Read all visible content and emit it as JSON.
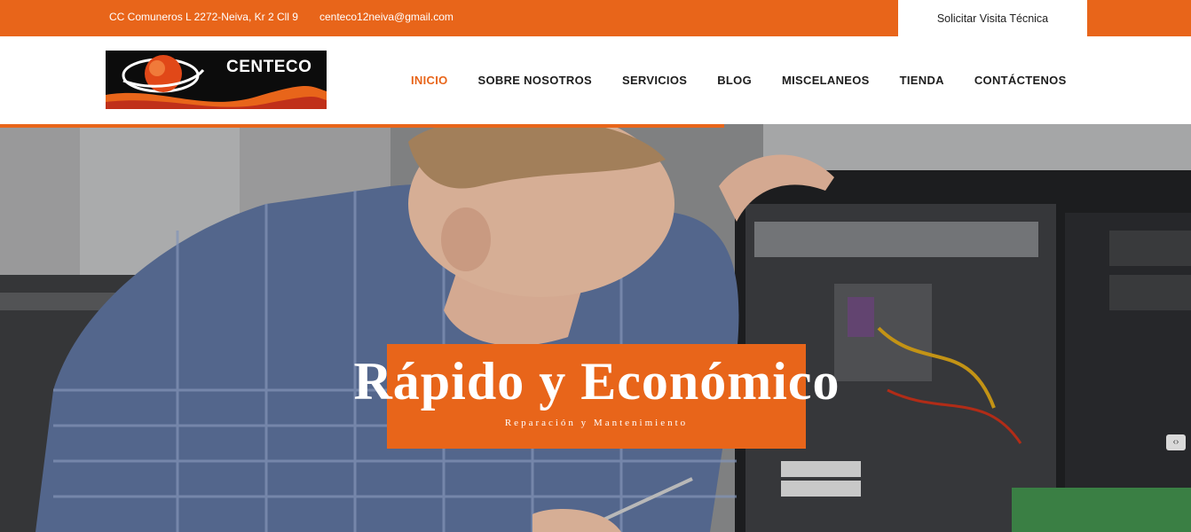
{
  "topbar": {
    "address": "CC Comuneros L 2272-Neiva, Kr 2 Cll 9",
    "email": "centeco12neiva@gmail.com",
    "visit_button": "Solicitar Visita Técnica"
  },
  "logo": {
    "text": "CENTECO"
  },
  "nav": {
    "items": [
      "INICIO",
      "SOBRE NOSOTROS",
      "SERVICIOS",
      "BLOG",
      "MISCELANEOS",
      "TIENDA",
      "CONTÁCTENOS"
    ],
    "active": "INICIO"
  },
  "hero": {
    "title": "Rápido y Económico",
    "subtitle": "Reparación y Mantenimiento"
  },
  "colors": {
    "accent": "#e8651a",
    "text_dark": "#1d1d1d"
  }
}
